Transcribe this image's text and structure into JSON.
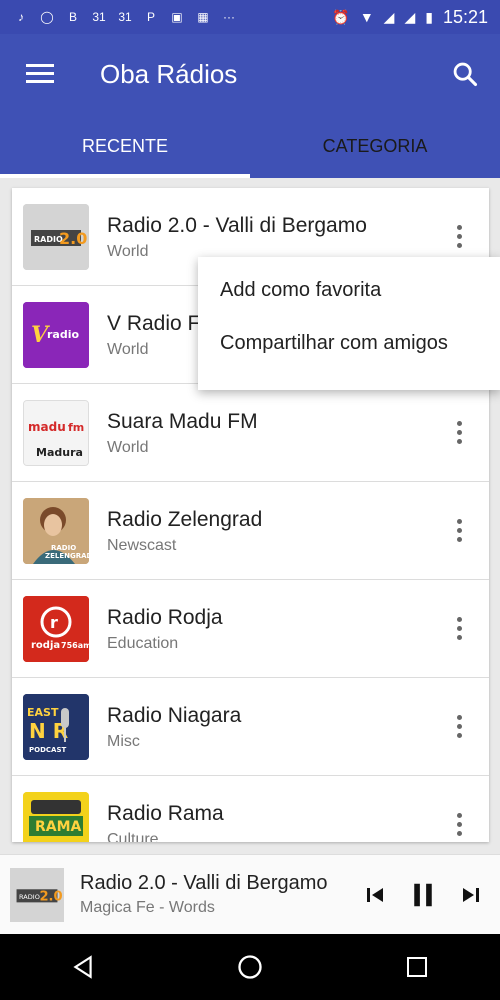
{
  "status_bar": {
    "icons": [
      "music-icon",
      "whatsapp-icon",
      "b-icon",
      "calendar-31-icon",
      "calendar-31-icon",
      "p-icon",
      "gallery-icon",
      "image-icon",
      "more-dots-icon",
      "alarm-icon",
      "wifi-icon",
      "signal-icon",
      "signal-icon",
      "battery-icon"
    ],
    "cal1": "31",
    "cal2": "31",
    "b_label": "B",
    "p_label": "P",
    "dots": "···",
    "time": "15:21"
  },
  "app_bar": {
    "title": "Oba Rádios",
    "color": "#3f51b5"
  },
  "tabs": [
    {
      "label": "RECENTE",
      "active": true
    },
    {
      "label": "CATEGORIA",
      "active": false
    }
  ],
  "stations": [
    {
      "name": "Radio 2.0 - Valli di Bergamo",
      "category": "World",
      "logo_text": "RADIO 2.0"
    },
    {
      "name": "V Radio F",
      "category": "World",
      "logo_text": "V radio"
    },
    {
      "name": "Suara Madu FM",
      "category": "World",
      "logo_text": "madu fm",
      "logo_caption": "Madura"
    },
    {
      "name": "Radio Zelengrad",
      "category": "Newscast",
      "logo_text": "RADIO ZELENGRAD"
    },
    {
      "name": "Radio Rodja",
      "category": "Education",
      "logo_text": "rodja 756am"
    },
    {
      "name": "Radio Niagara",
      "category": "Misc",
      "logo_text": "EAST NR PODCAST"
    },
    {
      "name": "Radio Rama",
      "category": "Culture",
      "logo_text": "RAMA"
    }
  ],
  "popup_menu": {
    "items": [
      "Add como favorita",
      "Compartilhar com amigos"
    ]
  },
  "player": {
    "title": "Radio 2.0 - Valli di Bergamo",
    "subtitle": "Magica Fe - Words",
    "logo_text": "RADIO 2.0",
    "state": "playing"
  }
}
